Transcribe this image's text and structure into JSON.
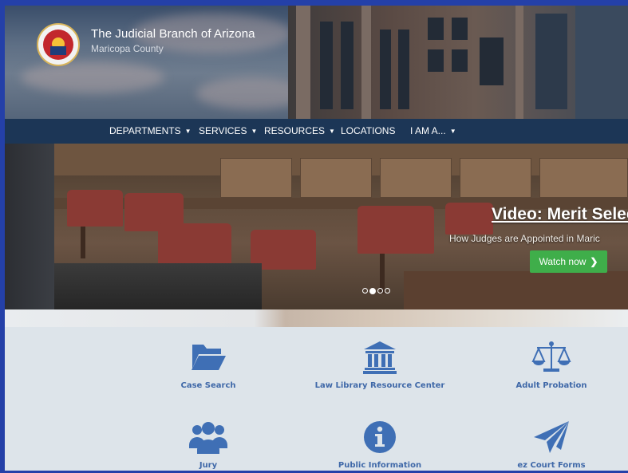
{
  "header": {
    "title": "The Judicial Branch of Arizona",
    "subtitle": "Maricopa County"
  },
  "nav": {
    "items": [
      {
        "label": "DEPARTMENTS",
        "dropdown": true
      },
      {
        "label": "SERVICES",
        "dropdown": true
      },
      {
        "label": "RESOURCES",
        "dropdown": true
      },
      {
        "label": "LOCATIONS",
        "dropdown": false
      },
      {
        "label": "I AM A...",
        "dropdown": true
      }
    ]
  },
  "hero": {
    "title": "Video: Merit Selecti",
    "subtitle": "How Judges are Appointed in Maric",
    "button_label": "Watch now",
    "slides_total": 4,
    "slide_active": 2
  },
  "quick_links": [
    {
      "label": "Case Search",
      "icon": "folder-open-icon"
    },
    {
      "label": "Law Library Resource Center",
      "icon": "courthouse-icon"
    },
    {
      "label": "Adult Probation",
      "icon": "scales-icon"
    },
    {
      "label": "Jury",
      "icon": "users-icon"
    },
    {
      "label": "Public Information",
      "icon": "info-icon"
    },
    {
      "label": "ez Court Forms",
      "icon": "paper-plane-icon"
    }
  ],
  "colors": {
    "nav_background": "#1c3656",
    "link_blue": "#3f68a8",
    "button_green": "#3fae4a",
    "page_background": "#dde4ea"
  }
}
